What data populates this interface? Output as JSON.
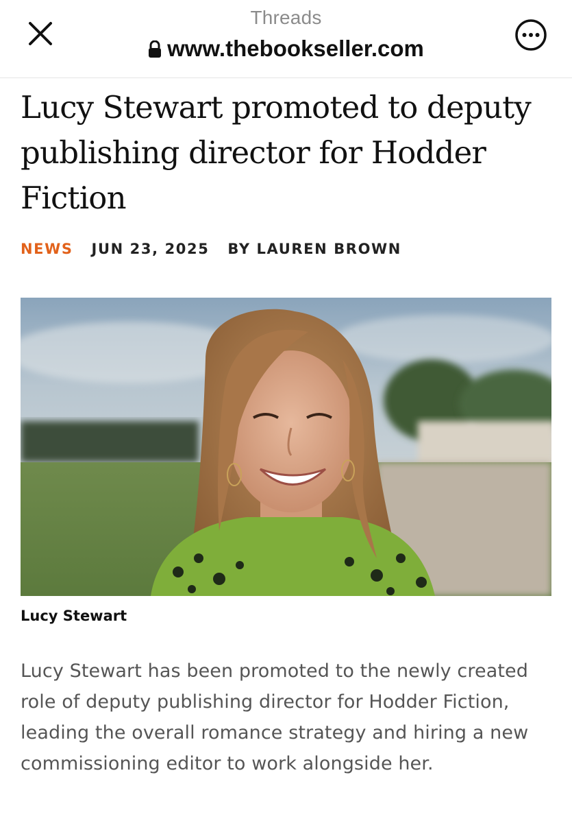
{
  "browser": {
    "app_name": "Threads",
    "url": "www.thebookseller.com",
    "close_icon": "close-icon",
    "more_icon": "more-options-icon",
    "lock_icon": "lock-icon"
  },
  "article": {
    "headline": "Lucy Stewart promoted to deputy publishing director for Hodder Fiction",
    "category": "NEWS",
    "date": "JUN 23, 2025",
    "byline": "BY LAUREN BROWN",
    "image_caption": "Lucy Stewart",
    "body": "Lucy Stewart has been promoted to the newly created role of deputy publishing director for Hodder Fiction, leading the overall romance strategy and hiring a new commissioning editor to work alongside her."
  },
  "colors": {
    "category_accent": "#e2621b",
    "body_text": "#555555",
    "headline_text": "#111111"
  }
}
